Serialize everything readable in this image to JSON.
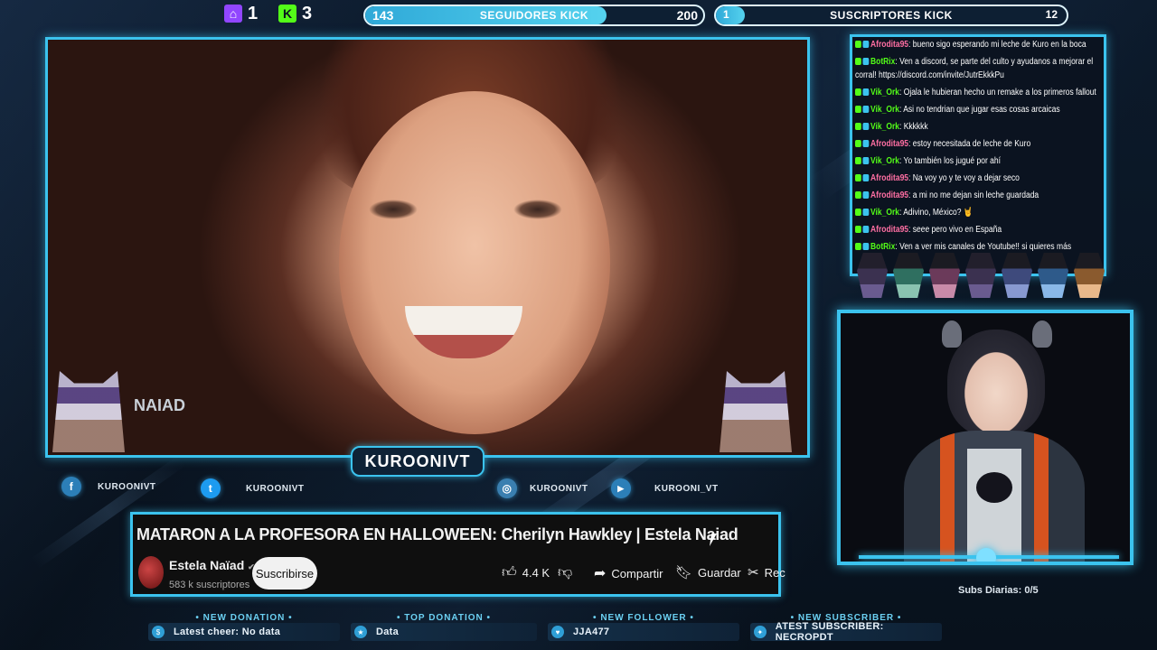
{
  "top": {
    "twitch_count": "1",
    "kick_count": "3",
    "followers_goal": {
      "current": "143",
      "label": "SEGUIDORES KICK",
      "target": "200",
      "progress": 0.715
    },
    "subs_goal": {
      "current": "1",
      "label": "SUSCRIPTORES KICK",
      "target": "12",
      "progress": 0.083
    }
  },
  "video": {
    "watermark": "NAIAD"
  },
  "channel_name": "KUROONIVT",
  "socials": [
    {
      "icon": "facebook-icon",
      "glyph": "f",
      "label": "KUROONIVT"
    },
    {
      "icon": "twitter-icon",
      "glyph": "t",
      "label": "KUROONIVT"
    },
    {
      "icon": "instagram-icon",
      "glyph": "◎",
      "label": "KUROONIVT"
    },
    {
      "icon": "youtube-icon",
      "glyph": "▶",
      "label": "KUROONI_VT"
    }
  ],
  "youtube": {
    "title": "MATARON A LA PROFESORA EN HALLOWEEN: Cherilyn Hawkley | Estela Naiad",
    "channel": "Estela Naïad",
    "verified": "✔",
    "subscribers": "583 k suscriptores",
    "subscribe_label": "Suscribirse",
    "likes": "4.4 K",
    "share_label": "Compartir",
    "save_label": "Guardar",
    "clip_label": "Rec"
  },
  "chat": [
    {
      "user": "Afrodita95",
      "color": "#ff6fa3",
      "text": ": bueno sigo esperando mi leche de Kuro en la boca"
    },
    {
      "user": "BotRix",
      "color": "#53fc18",
      "text": ": Ven a discord, se parte del culto y ayudanos a mejorar el corral! https://discord.com/invite/JutrEkkkPu"
    },
    {
      "user": "Vik_Ork",
      "color": "#53fc18",
      "text": ": Ojala le hubieran hecho un remake a los primeros fallout"
    },
    {
      "user": "Vik_Ork",
      "color": "#53fc18",
      "text": ": Asi no tendrian que jugar esas cosas arcaicas"
    },
    {
      "user": "Vik_Ork",
      "color": "#53fc18",
      "text": ": Kkkkkk"
    },
    {
      "user": "Afrodita95",
      "color": "#ff6fa3",
      "text": ": estoy necesitada de leche de Kuro"
    },
    {
      "user": "Vik_Ork",
      "color": "#53fc18",
      "text": ": Yo también los jugué por ahí"
    },
    {
      "user": "Afrodita95",
      "color": "#ff6fa3",
      "text": ": Na voy yo y te voy a dejar seco"
    },
    {
      "user": "Afrodita95",
      "color": "#ff6fa3",
      "text": ": a mi no me dejan sin leche guardada"
    },
    {
      "user": "Vik_Ork",
      "color": "#53fc18",
      "text": ": Adivino, México? 🤘"
    },
    {
      "user": "Afrodita95",
      "color": "#ff6fa3",
      "text": ": seee pero vivo en España"
    },
    {
      "user": "BotRix",
      "color": "#53fc18",
      "text": ": Ven a ver mis canales de Youtube!! si quieres más"
    }
  ],
  "subs_daily": "Subs Diarias:  0/5",
  "alerts": [
    {
      "title": "• NEW DONATION •",
      "value": "Latest cheer: No data"
    },
    {
      "title": "• TOP DONATION •",
      "value": "Data"
    },
    {
      "title": "• NEW FOLLOWER •",
      "value": "JJA477"
    },
    {
      "title": "• NEW SUBSCRIBER •",
      "value": "ATEST SUBSCRIBER: NECROPDT"
    }
  ],
  "colors": {
    "accent": "#3bc3ee",
    "kick": "#53fc18",
    "twitch": "#9146ff"
  }
}
